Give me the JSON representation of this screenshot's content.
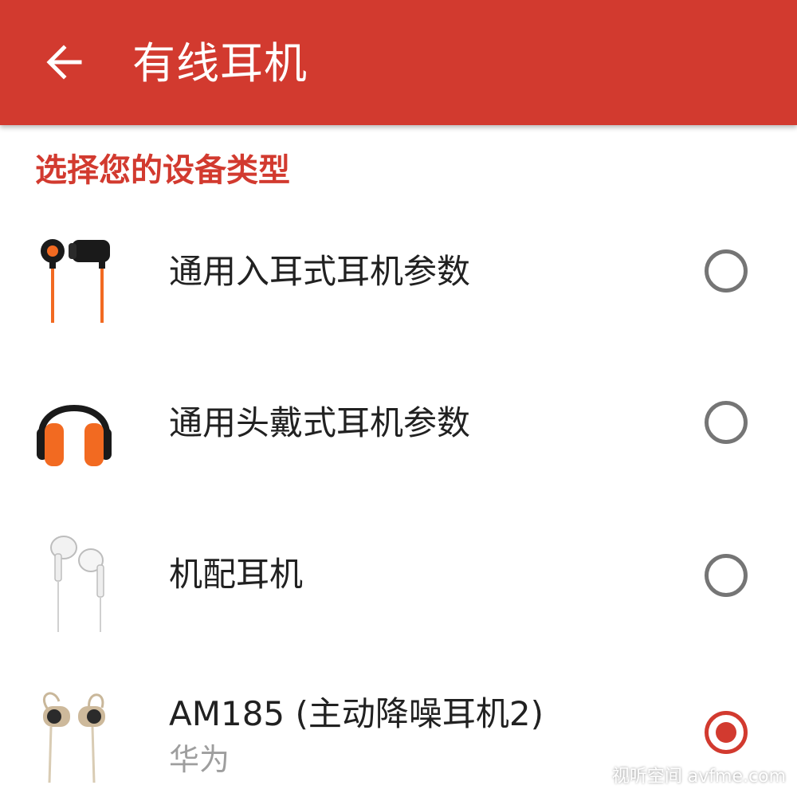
{
  "header": {
    "title": "有线耳机",
    "background_color": "#d23a2f",
    "back_icon": "arrow-back-icon"
  },
  "section": {
    "title": "选择您的设备类型",
    "color": "#d23a2f"
  },
  "devices": [
    {
      "label": "通用入耳式耳机参数",
      "subtitle": "",
      "icon": "in-ear-earphones-icon",
      "selected": false
    },
    {
      "label": "通用头戴式耳机参数",
      "subtitle": "",
      "icon": "over-ear-headphones-icon",
      "selected": false
    },
    {
      "label": "机配耳机",
      "subtitle": "",
      "icon": "stock-earphones-icon",
      "selected": false
    },
    {
      "label": "AM185 (主动降噪耳机2)",
      "subtitle": "华为",
      "icon": "noise-cancelling-earphones-icon",
      "selected": true
    }
  ],
  "watermark": {
    "text": "视听空间 avfme.com"
  }
}
